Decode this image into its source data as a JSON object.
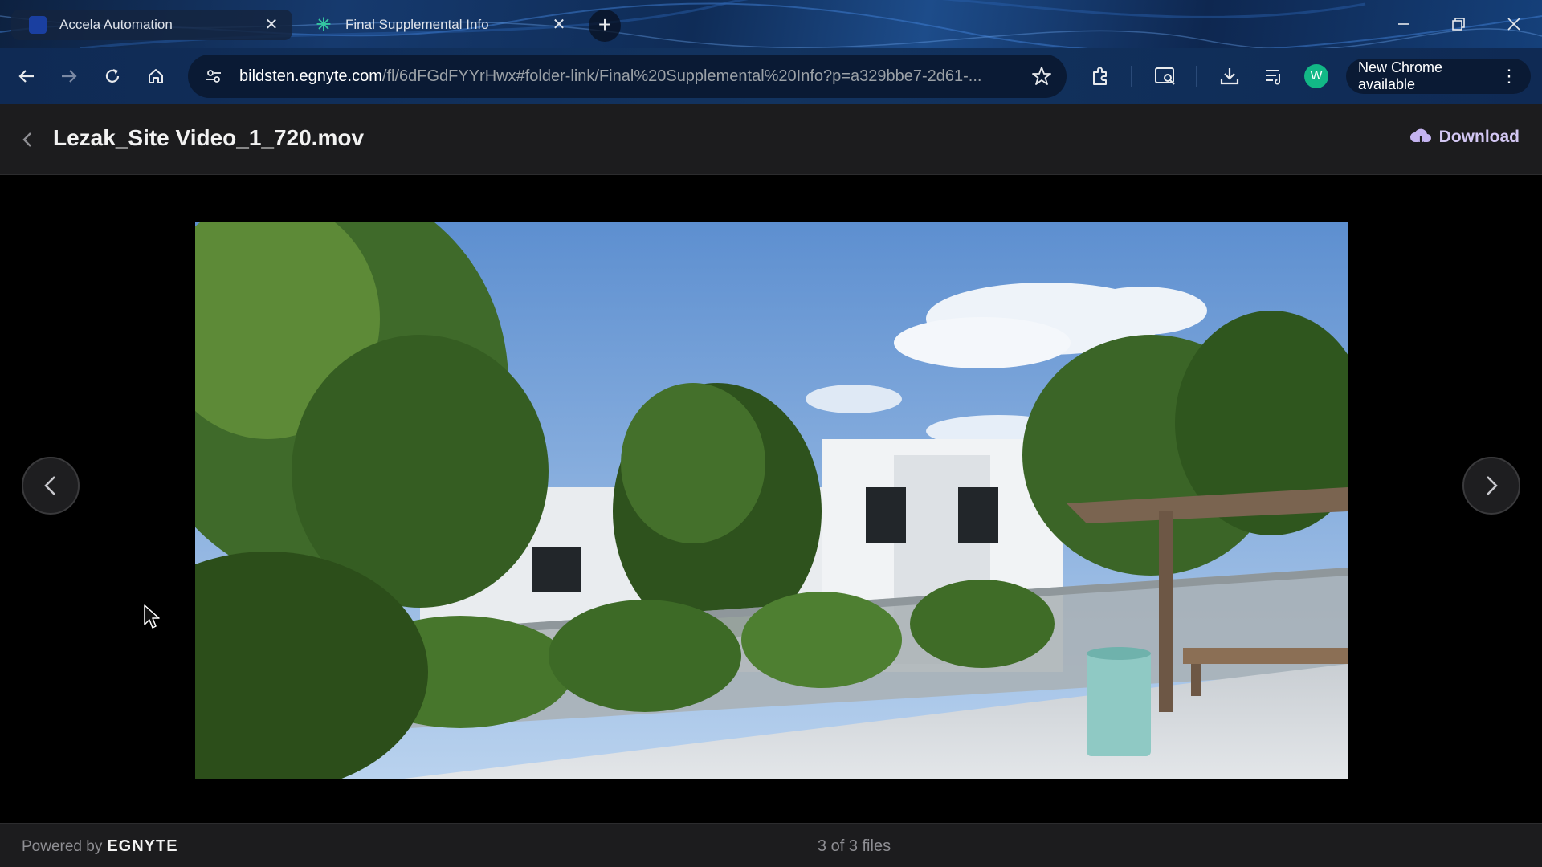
{
  "browser": {
    "tabs": [
      {
        "title": "Accela Automation",
        "active": false
      },
      {
        "title": "Final Supplemental Info",
        "active": true
      }
    ],
    "url_host": "bildsten.egnyte.com",
    "url_path": "/fl/6dFGdFYYrHwx#folder-link/Final%20Supplemental%20Info?p=a329bbe7-2d61-...",
    "profile_initial": "W",
    "update_label": "New Chrome available"
  },
  "viewer": {
    "file_title": "Lezak_Site Video_1_720.mov",
    "download_label": "Download",
    "powered_by_label": "Powered by",
    "brand_name": "EGNYTE",
    "file_count": "3 of 3 files"
  },
  "colors": {
    "accent_download": "#d2c6f2",
    "egnyte_teal": "#34c5a0",
    "avatar": "#12b886"
  }
}
